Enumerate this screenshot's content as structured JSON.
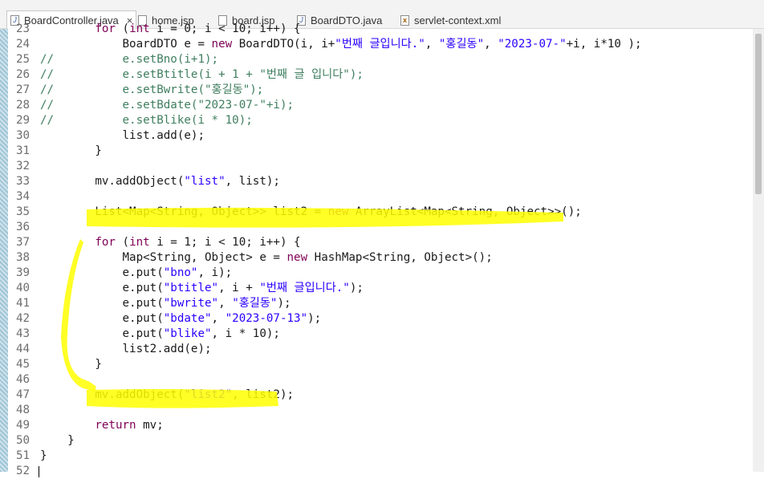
{
  "tabs": [
    {
      "label": "BoardController.java",
      "icon": "java-file-icon",
      "active": true,
      "close": "×"
    },
    {
      "label": "home.jsp",
      "icon": "jsp-file-icon"
    },
    {
      "label": "board.jsp",
      "icon": "jsp-file-icon"
    },
    {
      "label": "BoardDTO.java",
      "icon": "java-file-icon"
    },
    {
      "label": "servlet-context.xml",
      "icon": "xml-file-icon"
    }
  ],
  "editor": {
    "lines": [
      {
        "n": "23",
        "text": "        for (int i = 0; i < 10; i++) {"
      },
      {
        "n": "24",
        "text": "            BoardDTO e = new BoardDTO(i, i+\"번째 글입니다.\", \"홍길동\", \"2023-07-\"+i, i*10 );"
      },
      {
        "n": "25",
        "text": "//          e.setBno(i+1);"
      },
      {
        "n": "26",
        "text": "//          e.setBtitle(i + 1 + \"번째 글 입니다\");"
      },
      {
        "n": "27",
        "text": "//          e.setBwrite(\"홍길동\");"
      },
      {
        "n": "28",
        "text": "//          e.setBdate(\"2023-07-\"+i);"
      },
      {
        "n": "29",
        "text": "//          e.setBlike(i * 10);"
      },
      {
        "n": "30",
        "text": "            list.add(e);"
      },
      {
        "n": "31",
        "text": "        }"
      },
      {
        "n": "32",
        "text": ""
      },
      {
        "n": "33",
        "text": "        mv.addObject(\"list\", list);"
      },
      {
        "n": "34",
        "text": ""
      },
      {
        "n": "35",
        "text": "        List<Map<String, Object>> list2 = new ArrayList<Map<String, Object>>();"
      },
      {
        "n": "36",
        "text": ""
      },
      {
        "n": "37",
        "text": "        for (int i = 1; i < 10; i++) {"
      },
      {
        "n": "38",
        "text": "            Map<String, Object> e = new HashMap<String, Object>();"
      },
      {
        "n": "39",
        "text": "            e.put(\"bno\", i);"
      },
      {
        "n": "40",
        "text": "            e.put(\"btitle\", i + \"번째 글입니다.\");"
      },
      {
        "n": "41",
        "text": "            e.put(\"bwrite\", \"홍길동\");"
      },
      {
        "n": "42",
        "text": "            e.put(\"bdate\", \"2023-07-13\");"
      },
      {
        "n": "43",
        "text": "            e.put(\"blike\", i * 10);"
      },
      {
        "n": "44",
        "text": "            list2.add(e);"
      },
      {
        "n": "45",
        "text": "        }"
      },
      {
        "n": "46",
        "text": ""
      },
      {
        "n": "47",
        "text": "        mv.addObject(\"list2\", list2);"
      },
      {
        "n": "48",
        "text": ""
      },
      {
        "n": "49",
        "text": "        return mv;"
      },
      {
        "n": "50",
        "text": "    }"
      },
      {
        "n": "51",
        "text": "}"
      },
      {
        "n": "52",
        "text": ""
      }
    ]
  },
  "colors": {
    "highlight": "#ffff00",
    "comment": "#3f7f5f",
    "keyword": "#7f0055",
    "string": "#2a00ff"
  }
}
